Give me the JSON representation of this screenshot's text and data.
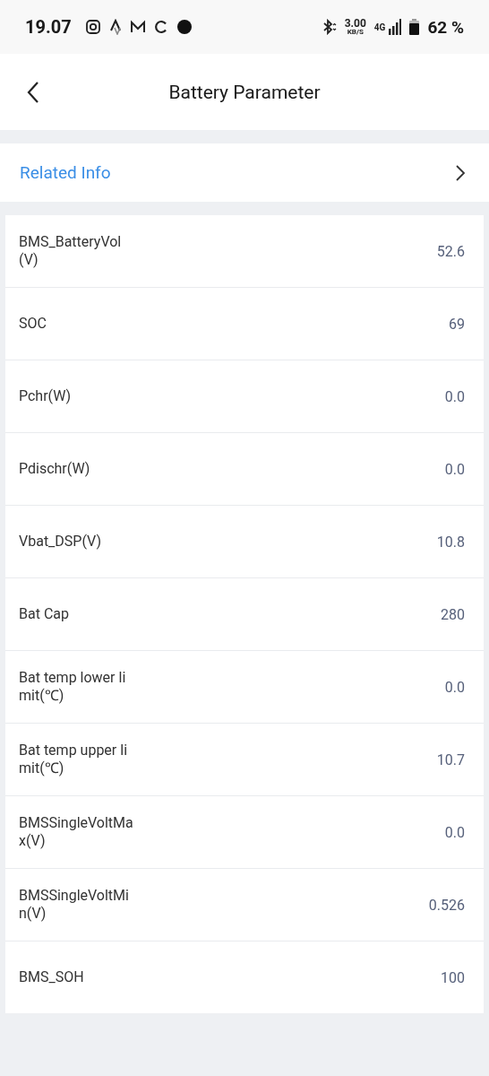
{
  "status_bar": {
    "time": "19.07",
    "speed": "3.00",
    "speed_unit": "KB/S",
    "network": "4G",
    "battery": "62 %"
  },
  "header": {
    "title": "Battery Parameter"
  },
  "related_info": {
    "label": "Related Info"
  },
  "parameters": [
    {
      "label": "BMS_BatteryVol(V)",
      "value": "52.6"
    },
    {
      "label": "SOC",
      "value": "69"
    },
    {
      "label": "Pchr(W)",
      "value": "0.0"
    },
    {
      "label": "Pdischr(W)",
      "value": "0.0"
    },
    {
      "label": "Vbat_DSP(V)",
      "value": "10.8"
    },
    {
      "label": "Bat Cap",
      "value": "280"
    },
    {
      "label": "Bat temp lower limit(℃)",
      "value": "0.0"
    },
    {
      "label": "Bat temp upper limit(℃)",
      "value": "10.7"
    },
    {
      "label": "BMSSingleVoltMax(V)",
      "value": "0.0"
    },
    {
      "label": "BMSSingleVoltMin(V)",
      "value": "0.526"
    },
    {
      "label": "BMS_SOH",
      "value": "100"
    }
  ]
}
